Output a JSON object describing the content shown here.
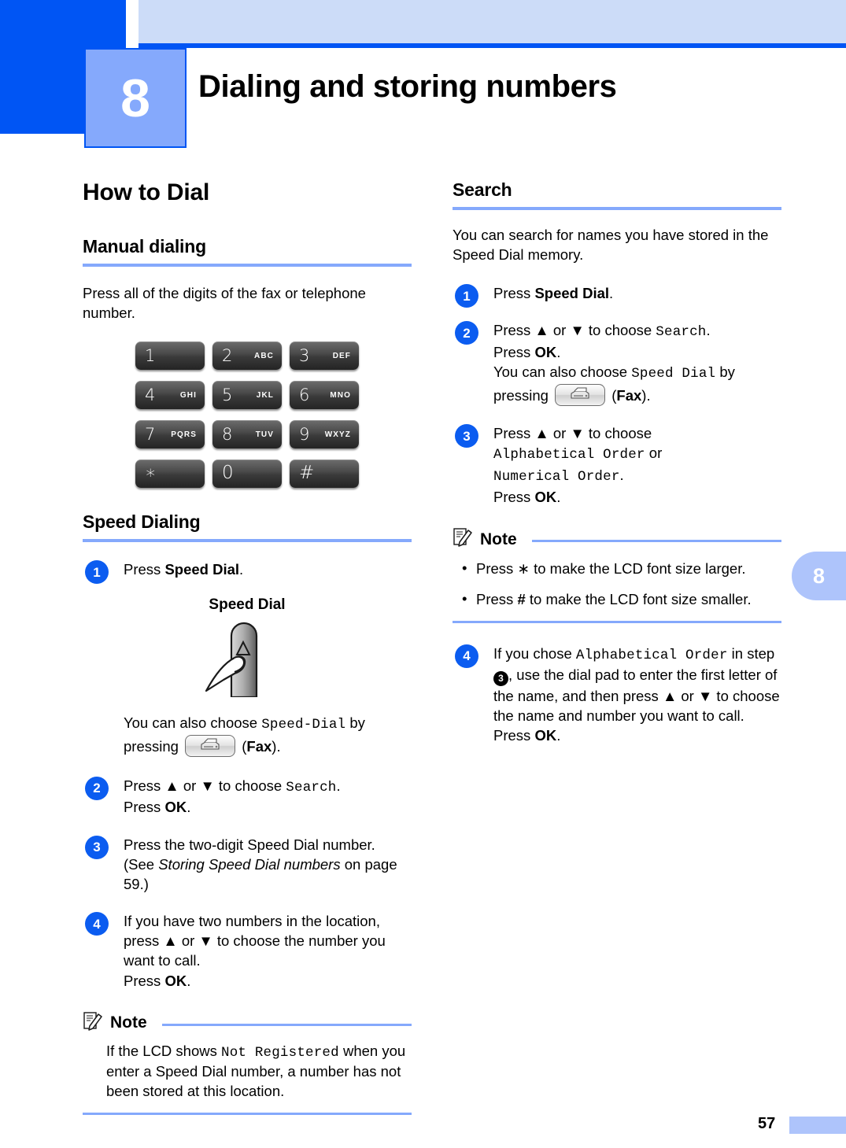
{
  "header": {
    "chapter_number": "8",
    "chapter_title": "Dialing and storing numbers",
    "side_tab_number": "8"
  },
  "footer": {
    "page_number": "57"
  },
  "colors": {
    "dark_blue": "#0055f4",
    "light_blue_bar": "#ccdcf8",
    "accent_blue": "#85a9fc",
    "badge_blue": "#0b5cf0",
    "tab_blue": "#aec4fb"
  },
  "left_column": {
    "main_heading": "How to Dial",
    "manual_dialing": {
      "heading": "Manual dialing",
      "paragraph": "Press all of the digits of the fax or telephone number."
    },
    "keypad": {
      "keys": [
        {
          "digit": "1",
          "letters": ""
        },
        {
          "digit": "2",
          "letters": "ABC"
        },
        {
          "digit": "3",
          "letters": "DEF"
        },
        {
          "digit": "4",
          "letters": "GHI"
        },
        {
          "digit": "5",
          "letters": "JKL"
        },
        {
          "digit": "6",
          "letters": "MNO"
        },
        {
          "digit": "7",
          "letters": "PQRS"
        },
        {
          "digit": "8",
          "letters": "TUV"
        },
        {
          "digit": "9",
          "letters": "WXYZ"
        },
        {
          "digit": "∗",
          "letters": ""
        },
        {
          "digit": "0",
          "letters": ""
        },
        {
          "digit": "#",
          "letters": ""
        }
      ]
    },
    "speed_dialing": {
      "heading": "Speed Dialing",
      "steps": [
        {
          "badge": "1",
          "text_before_bold": "Press ",
          "bold": "Speed Dial",
          "text_after_bold": "."
        },
        {
          "badge": "2",
          "line1_a": "Press ▲ or ▼ to choose ",
          "line1_mono": "Search",
          "line1_b": ".",
          "line2_a": "Press ",
          "line2_bold": "OK",
          "line2_b": "."
        },
        {
          "badge": "3",
          "line1": "Press the two-digit Speed Dial number.",
          "line2_a": "(See ",
          "line2_italic": "Storing Speed Dial numbers",
          "line2_b": " on page 59.)"
        },
        {
          "badge": "4",
          "line1": "If you have two numbers in the location, press ▲ or ▼ to choose the number you want to call.",
          "line2_a": "Press ",
          "line2_bold": "OK",
          "line2_b": "."
        }
      ],
      "speed_dial_graphic_label": "Speed Dial",
      "also_choose": {
        "text_a": "You can also choose ",
        "mono": "Speed-Dial",
        "text_b": " by pressing ",
        "icon": "fax-key-icon",
        "text_c": " (",
        "bold": "Fax",
        "text_d": ")."
      }
    },
    "note": {
      "title": "Note",
      "text_a": "If the LCD shows ",
      "mono": "Not Registered",
      "text_b": " when you enter a Speed Dial number, a number has not been stored at this location."
    }
  },
  "right_column": {
    "search": {
      "heading": "Search",
      "paragraph": "You can search for names you have stored in the Speed Dial memory.",
      "steps": [
        {
          "badge": "1",
          "text_before_bold": "Press ",
          "bold": "Speed Dial",
          "text_after_bold": "."
        },
        {
          "badge": "2",
          "line1_a": "Press ▲ or ▼ to choose ",
          "line1_mono": "Search",
          "line1_b": ".",
          "line2_a": "Press ",
          "line2_bold": "OK",
          "line2_b": ".",
          "line3_a": "You can also choose ",
          "line3_mono": "Speed Dial",
          "line3_b": " by pressing ",
          "line3_icon": "fax-key-icon",
          "line3_c": " (",
          "line3_bold": "Fax",
          "line3_d": ")."
        },
        {
          "badge": "3",
          "line1": "Press ▲ or ▼ to choose",
          "line2_mono": "Alphabetical Order",
          "line2_b": " or",
          "line3_mono": "Numerical Order",
          "line3_b": ".",
          "line4_a": "Press ",
          "line4_bold": "OK",
          "line4_b": "."
        },
        {
          "badge": "4",
          "line1_a": "If you chose ",
          "line1_mono": "Alphabetical Order",
          "line1_b": " in step ",
          "inline_badge": "3",
          "line1_c": ", use the dial pad to enter the first letter of the name, and then press ▲ or ▼ to choose the name and number you want to call.",
          "line2_a": "Press ",
          "line2_bold": "OK",
          "line2_b": "."
        }
      ]
    },
    "note": {
      "title": "Note",
      "bullets": [
        {
          "text_a": "Press ",
          "sym": "∗",
          "sym_bold": false,
          "text_b": " to make the LCD font size larger."
        },
        {
          "text_a": "Press ",
          "sym": "#",
          "sym_bold": true,
          "text_b": " to make the LCD font size smaller."
        }
      ]
    }
  }
}
